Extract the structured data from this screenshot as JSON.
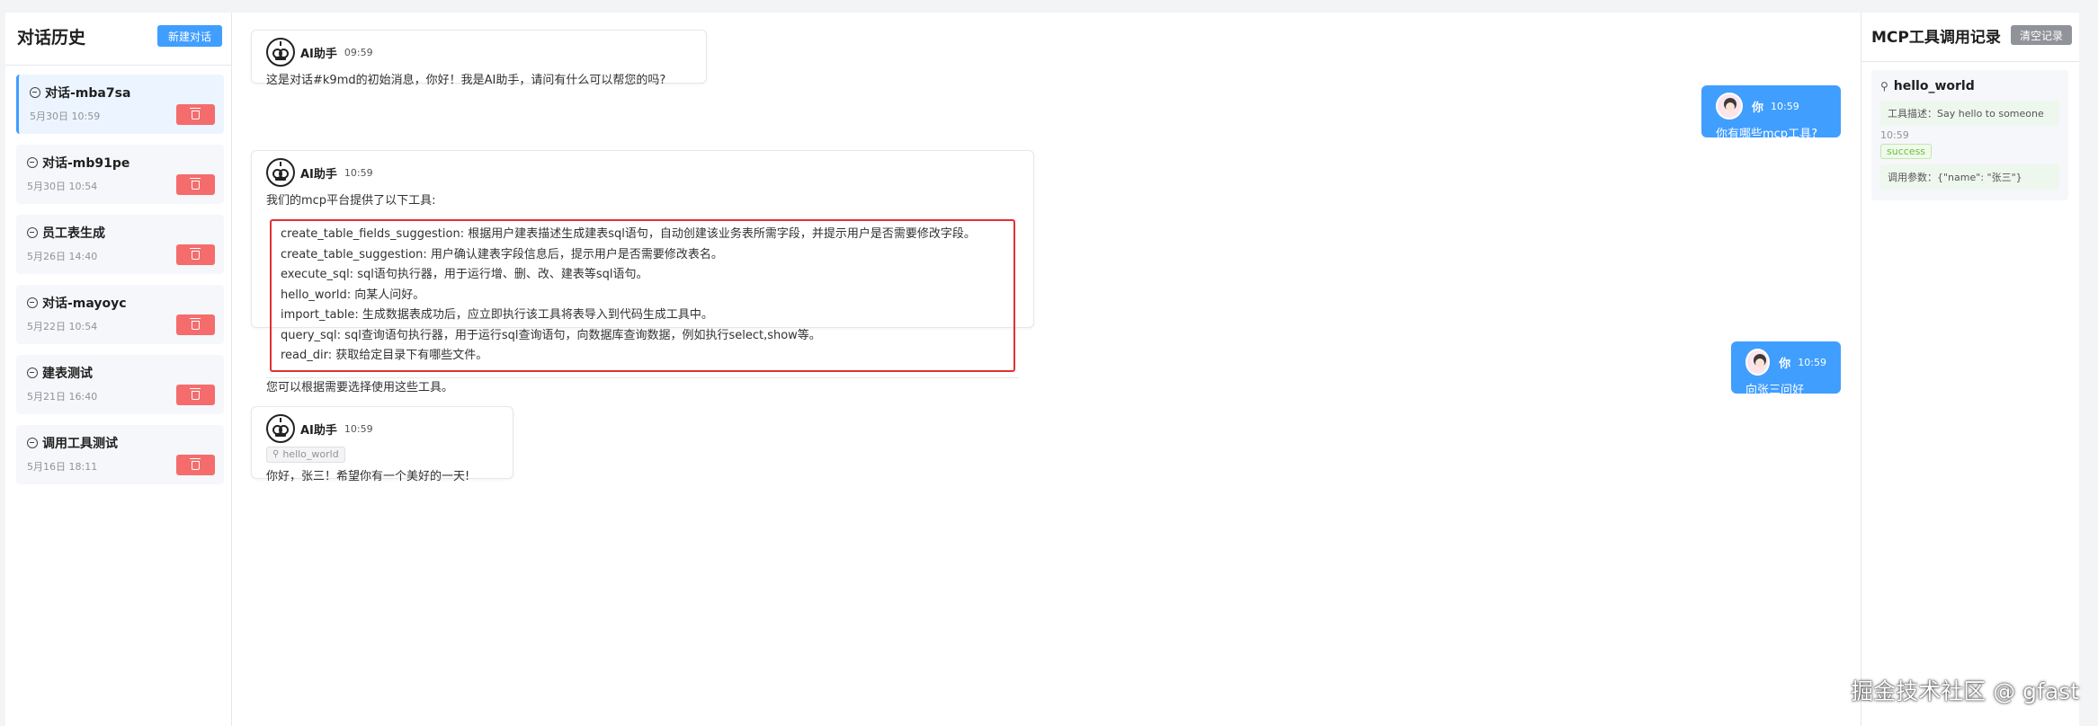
{
  "sidebar": {
    "title": "对话历史",
    "new_button": "新建对话",
    "conversations": [
      {
        "name": "对话-mba7sa",
        "time": "5月30日 10:59",
        "active": true
      },
      {
        "name": "对话-mb91pe",
        "time": "5月30日 10:54"
      },
      {
        "name": "员工表生成",
        "time": "5月26日 14:40"
      },
      {
        "name": "对话-mayoyc",
        "time": "5月22日 10:54"
      },
      {
        "name": "建表测试",
        "time": "5月21日 16:40"
      },
      {
        "name": "调用工具测试",
        "time": "5月16日 18:11"
      }
    ]
  },
  "messages": {
    "m1": {
      "sender": "AI助手",
      "time": "09:59",
      "text": "这是对话#k9md的初始消息，你好！我是AI助手，请问有什么可以帮您的吗?"
    },
    "m2": {
      "sender": "你",
      "time": "10:59",
      "text": "你有哪些mcp工具?"
    },
    "m3": {
      "sender": "AI助手",
      "time": "10:59",
      "intro": "我们的mcp平台提供了以下工具:",
      "tools": [
        "create_table_fields_suggestion: 根据用户建表描述生成建表sql语句，自动创建该业务表所需字段，并提示用户是否需要修改字段。",
        "create_table_suggestion: 用户确认建表字段信息后，提示用户是否需要修改表名。",
        "execute_sql: sql语句执行器，用于运行增、删、改、建表等sql语句。",
        "hello_world: 向某人问好。",
        "import_table: 生成数据表成功后，应立即执行该工具将表导入到代码生成工具中。",
        "query_sql: sql查询语句执行器，用于运行sql查询语句，向数据库查询数据，例如执行select,show等。",
        "read_dir: 获取给定目录下有哪些文件。"
      ],
      "outro": "您可以根据需要选择使用这些工具。"
    },
    "m4": {
      "sender": "你",
      "time": "10:59",
      "text": "向张三问好"
    },
    "m5": {
      "sender": "AI助手",
      "time": "10:59",
      "tool_tag": "hello_world",
      "text": "你好，张三！希望你有一个美好的一天!"
    }
  },
  "mcp_panel": {
    "title": "MCP工具调用记录",
    "clear_button": "清空记录",
    "log": {
      "tool_name": "hello_world",
      "description": "工具描述：Say hello to someone",
      "time": "10:59",
      "status": "success",
      "params": "调用参数：{\"name\": \"张三\"}"
    }
  },
  "watermark": "掘金技术社区 @ gfast",
  "colors": {
    "primary": "#409eff",
    "danger": "#f56c6c",
    "highlight_border": "#e03131",
    "success": "#67c23a"
  }
}
